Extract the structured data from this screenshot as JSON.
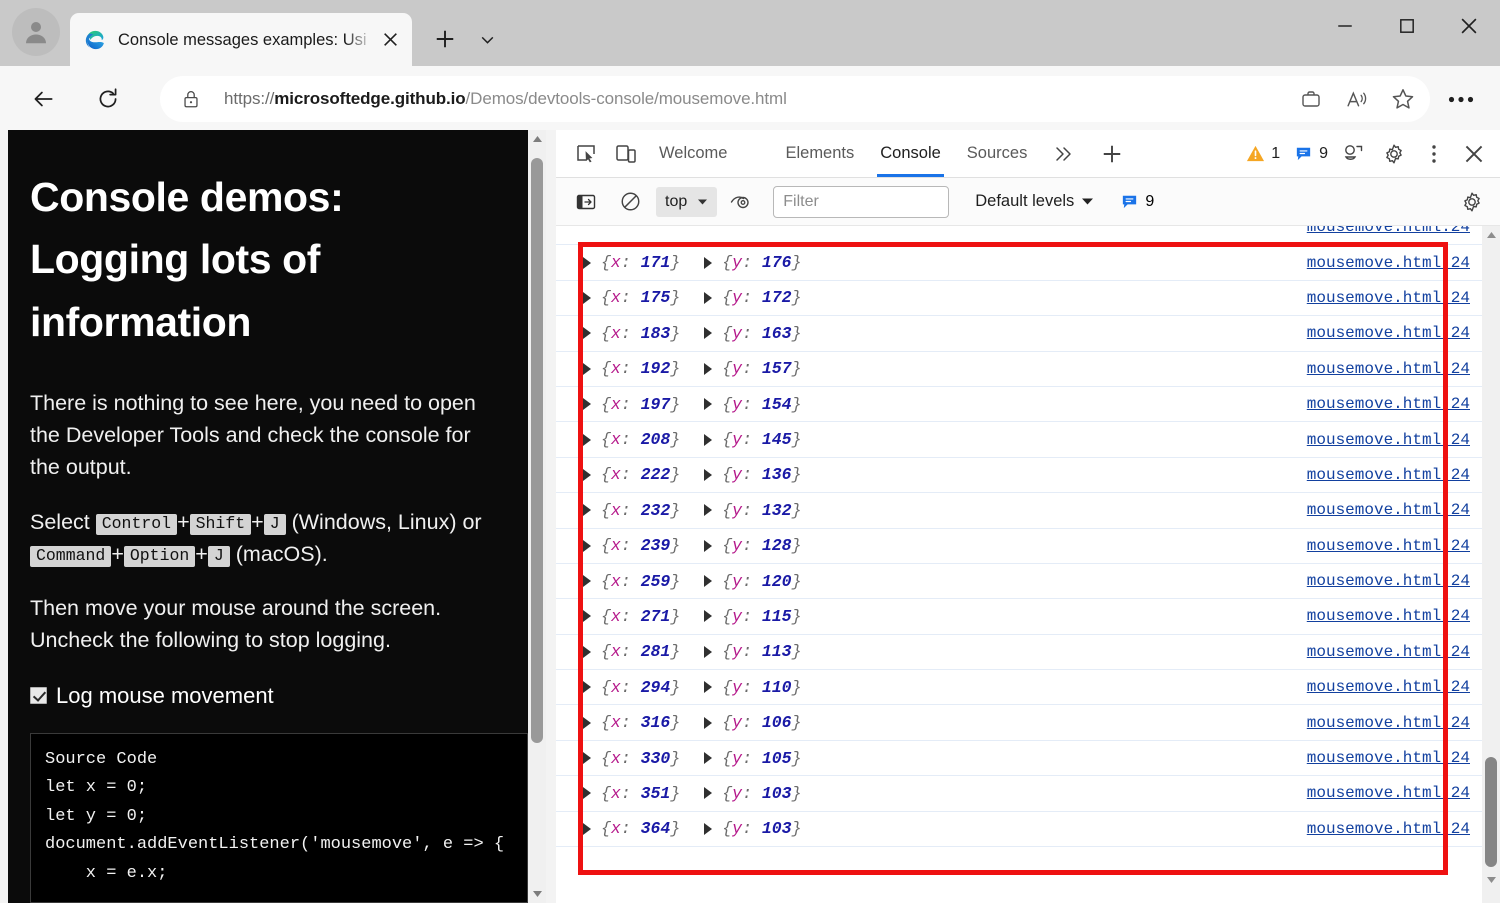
{
  "window": {
    "minimize_label": "Minimize",
    "maximize_label": "Maximize",
    "close_label": "Close"
  },
  "browser": {
    "tab": {
      "title": "Console messages examples: Usi",
      "favicon": "edge-logo-icon",
      "close_label": "Close tab"
    },
    "new_tab_label": "New tab",
    "tab_menu_label": "Tab actions menu",
    "nav": {
      "back_label": "Back",
      "reload_label": "Refresh"
    },
    "url": {
      "scheme": "https://",
      "host": "microsoftedge.github.io",
      "path": "/Demos/devtools-console/mousemove.html",
      "full": "https://microsoftedge.github.io/Demos/devtools-console/mousemove.html",
      "lock_icon": "lock-icon"
    },
    "toolbar_icons": [
      {
        "name": "collections-icon",
        "label": "Collections"
      },
      {
        "name": "read-aloud-icon",
        "label": "Read aloud"
      },
      {
        "name": "favorites-star-icon",
        "label": "Add this page to favorites"
      }
    ],
    "settings_more_label": "Settings and more"
  },
  "page": {
    "heading": "Console demos: Logging lots of information",
    "paragraph_1": "There is nothing to see here, you need to open the Developer Tools and check the console for the output.",
    "select_word": "Select",
    "keys_windows": [
      "Control",
      "Shift",
      "J"
    ],
    "os_windows": "(Windows, Linux) or",
    "keys_mac": [
      "Command",
      "Option",
      "J"
    ],
    "os_mac": "(macOS).",
    "paragraph_2": "Then move your mouse around the screen. Uncheck the following to stop logging.",
    "checkbox_label": "Log mouse movement",
    "checkbox_checked": true,
    "source_code_title": "Source Code",
    "source_code": "let x = 0;\nlet y = 0;\ndocument.addEventListener('mousemove', e => {\n    x = e.x;",
    "bg_color": "#0b0b0b",
    "accent_green": "#22d422"
  },
  "devtools": {
    "tabs": [
      {
        "label": "Welcome",
        "active": false
      },
      {
        "label": "Elements",
        "active": false
      },
      {
        "label": "Console",
        "active": true
      },
      {
        "label": "Sources",
        "active": false
      }
    ],
    "more_tabs_label": "More tools",
    "add_tab_label": "More Tools",
    "inspect_icon_label": "Inspect tool",
    "device_icon_label": "Device emulation",
    "warning_count": "1",
    "message_count": "9",
    "customize_label": "Customize and control DevTools",
    "settings_label": "Settings",
    "more_options_label": "More options",
    "close_label": "Close DevTools",
    "focus_mode_label": "Focus mode",
    "active_tab_underline_color": "#1a73e8",
    "warning_color": "#f5a623",
    "info_color": "#1a73e8"
  },
  "console_toolbar": {
    "sidebar_toggle_label": "Show console sidebar",
    "clear_label": "Clear console",
    "context": "top",
    "live_expression_label": "Create live expression",
    "filter_placeholder": "Filter",
    "filter_value": "",
    "levels_label": "Default levels",
    "levels_count": "9",
    "settings_label": "Console settings"
  },
  "console_log": {
    "source_link": "mousemove.html:24",
    "x_key": "x",
    "y_key": "y",
    "entries": [
      {
        "x": "171",
        "y": "176"
      },
      {
        "x": "175",
        "y": "172"
      },
      {
        "x": "183",
        "y": "163"
      },
      {
        "x": "192",
        "y": "157"
      },
      {
        "x": "197",
        "y": "154"
      },
      {
        "x": "208",
        "y": "145"
      },
      {
        "x": "222",
        "y": "136"
      },
      {
        "x": "232",
        "y": "132"
      },
      {
        "x": "239",
        "y": "128"
      },
      {
        "x": "259",
        "y": "120"
      },
      {
        "x": "271",
        "y": "115"
      },
      {
        "x": "281",
        "y": "113"
      },
      {
        "x": "294",
        "y": "110"
      },
      {
        "x": "316",
        "y": "106"
      },
      {
        "x": "330",
        "y": "105"
      },
      {
        "x": "351",
        "y": "103"
      },
      {
        "x": "364",
        "y": "103"
      }
    ],
    "highlight_color": "#ee1111"
  }
}
